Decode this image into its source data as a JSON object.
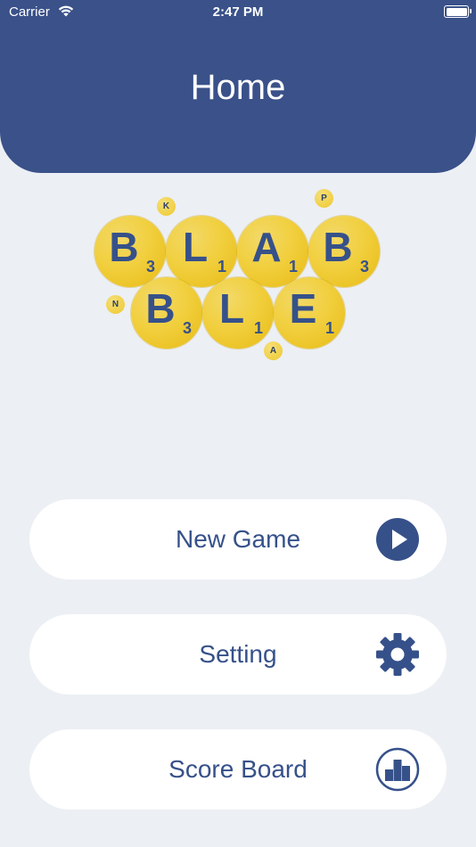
{
  "status_bar": {
    "carrier": "Carrier",
    "time": "2:47 PM"
  },
  "header": {
    "title": "Home"
  },
  "logo": {
    "row1": [
      {
        "letter": "B",
        "score": "3"
      },
      {
        "letter": "L",
        "score": "1"
      },
      {
        "letter": "A",
        "score": "1"
      },
      {
        "letter": "B",
        "score": "3"
      }
    ],
    "row2": [
      {
        "letter": "B",
        "score": "3"
      },
      {
        "letter": "L",
        "score": "1"
      },
      {
        "letter": "E",
        "score": "1"
      }
    ],
    "bubbles": [
      "K",
      "P",
      "N",
      "A"
    ]
  },
  "menu": {
    "new_game": {
      "label": "New Game",
      "icon": "play-circle-icon"
    },
    "setting": {
      "label": "Setting",
      "icon": "gear-icon"
    },
    "score_board": {
      "label": "Score Board",
      "icon": "podium-icon"
    }
  },
  "colors": {
    "header": "#3a5189",
    "text": "#36518a",
    "tile": "#f1cf3e",
    "background": "#eceff4"
  }
}
